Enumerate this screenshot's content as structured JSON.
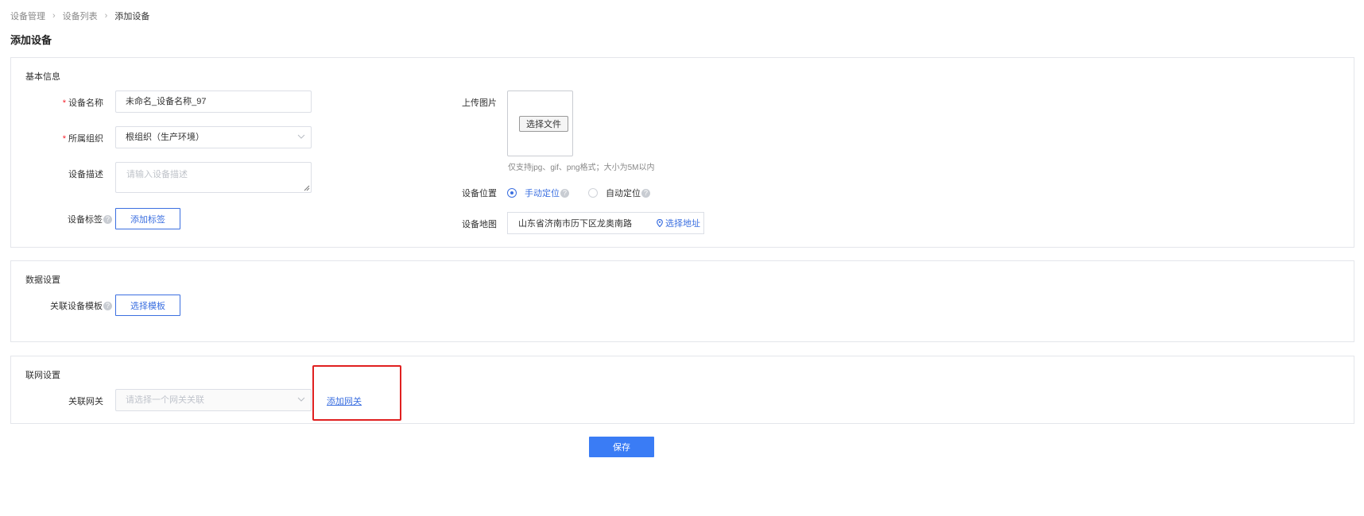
{
  "breadcrumb": {
    "items": [
      "设备管理",
      "设备列表",
      "添加设备"
    ]
  },
  "page_title": "添加设备",
  "basic_info": {
    "title": "基本信息",
    "device_name": {
      "required_mark": "*",
      "label": "设备名称",
      "value": "未命名_设备名称_97"
    },
    "organization": {
      "required_mark": "*",
      "label": "所属组织",
      "value": "根组织（生产环境）"
    },
    "description": {
      "label": "设备描述",
      "placeholder": "请输入设备描述"
    },
    "tags": {
      "label": "设备标签",
      "help": "?",
      "button": "添加标签"
    },
    "upload": {
      "label": "上传图片",
      "button": "选择文件",
      "hint": "仅支持jpg、gif、png格式；大小为5M以内"
    },
    "location": {
      "label": "设备位置",
      "options": [
        {
          "label": "手动定位",
          "help": "?"
        },
        {
          "label": "自动定位",
          "help": "?"
        }
      ],
      "selected": "手动定位"
    },
    "map": {
      "label": "设备地图",
      "value": "山东省济南市历下区龙奥南路",
      "link": "选择地址"
    }
  },
  "data_settings": {
    "title": "数据设置",
    "template": {
      "label": "关联设备模板",
      "help": "?",
      "button": "选择模板"
    }
  },
  "network": {
    "title": "联网设置",
    "gateway": {
      "label": "关联网关",
      "placeholder": "请选择一个网关关联",
      "link": "添加网关"
    }
  },
  "save_label": "保存",
  "colors": {
    "primary": "#3a7cf5",
    "required": "#f5222d",
    "highlight": "#e02020"
  },
  "icons": {
    "separator": "chevron-right-icon",
    "select": "chevron-down-icon",
    "map": "location-pin-icon"
  }
}
